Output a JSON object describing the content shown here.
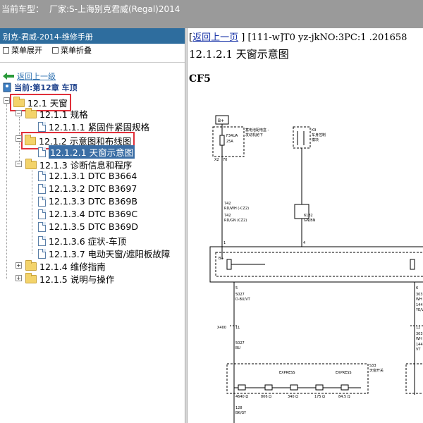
{
  "topbar": {
    "label": "当前车型：",
    "maker": "厂家:S-上海别克君威(Regal)2014"
  },
  "sidebar": {
    "title": "别克-君威-2014-维修手册",
    "expand_all": "菜单展开",
    "collapse_all": "菜单折叠",
    "back_link": "返回上一级",
    "current": "当前:第12章 车顶",
    "tree": [
      {
        "label": "12.1 天窗"
      },
      {
        "label": "12.1.1 规格"
      },
      {
        "label": "12.1.1.1 紧固件紧固规格"
      },
      {
        "label": "12.1.2 示意图和布线图"
      },
      {
        "label": "12.1.2.1 天窗示意图"
      },
      {
        "label": "12.1.3 诊断信息和程序"
      },
      {
        "label": "12.1.3.1 DTC B3664"
      },
      {
        "label": "12.1.3.2 DTC B3697"
      },
      {
        "label": "12.1.3.3 DTC B369B"
      },
      {
        "label": "12.1.3.4 DTC B369C"
      },
      {
        "label": "12.1.3.5 DTC B369D"
      },
      {
        "label": "12.1.3.6 症状-车顶"
      },
      {
        "label": "12.1.3.7 电动天窗/遮阳板故障"
      },
      {
        "label": "12.1.4 维修指南"
      },
      {
        "label": "12.1.5 说明与操作"
      }
    ]
  },
  "content": {
    "back_link": "返回上一页",
    "path": "[111-w]T0 yz-jkNO:3PC:1 .201658",
    "section_title": "12.1.2.1 天窗示意图",
    "diagram_code": "CF5",
    "wiring": {
      "bplus": "B+",
      "fuse_name": "F34UA",
      "fuse_rating": "25A",
      "fuse_desc1": "蓄电池配电盒 -",
      "fuse_desc2": "发动机舱下",
      "conn_x2": "X2",
      "pin70": "70",
      "relay_label1": "K9",
      "relay_label2": "车身控制",
      "relay_label3": "模块",
      "w742a": "742",
      "w742a_color": "RD/WH (-CZ2)",
      "w742b": "742",
      "w742b_color": "RD/GN (CZ2)",
      "w6132": "6132",
      "w6132_color": "GN/BN",
      "pin1": "1",
      "pin4": "4",
      "bplus2": "B+",
      "pin5": "5",
      "w5027a": "5027",
      "w5027a_color": "D-BU/VT",
      "pin6": "6",
      "w3031a": "3031",
      "w3031a_color": "WH",
      "w144a": "144",
      "w144a_color": "YE/V",
      "conn_x400": "X400",
      "pin11": "11",
      "pin12": "12",
      "w5027b": "5027",
      "w5027b_color": "BU",
      "w3031b": "3031",
      "w3031b_color": "WH",
      "w144b": "144",
      "w144b_color": "VT",
      "s33": "S33",
      "switch_name": "天窗开关",
      "express1": "EXPRESS",
      "express2": "EXPRESS",
      "r1": "4640 Ω",
      "r2": "806 Ω",
      "r3": "340 Ω",
      "r4": "175 Ω",
      "r5": "84.5 Ω",
      "w128": "128",
      "w128_color": "BK/GY"
    }
  },
  "colors": {
    "topbar": "#9a9a9a",
    "sidebar_title": "#2e6d9e",
    "highlight": "#e0303a",
    "selection": "#3b6ea5",
    "link": "#1a35a8"
  }
}
